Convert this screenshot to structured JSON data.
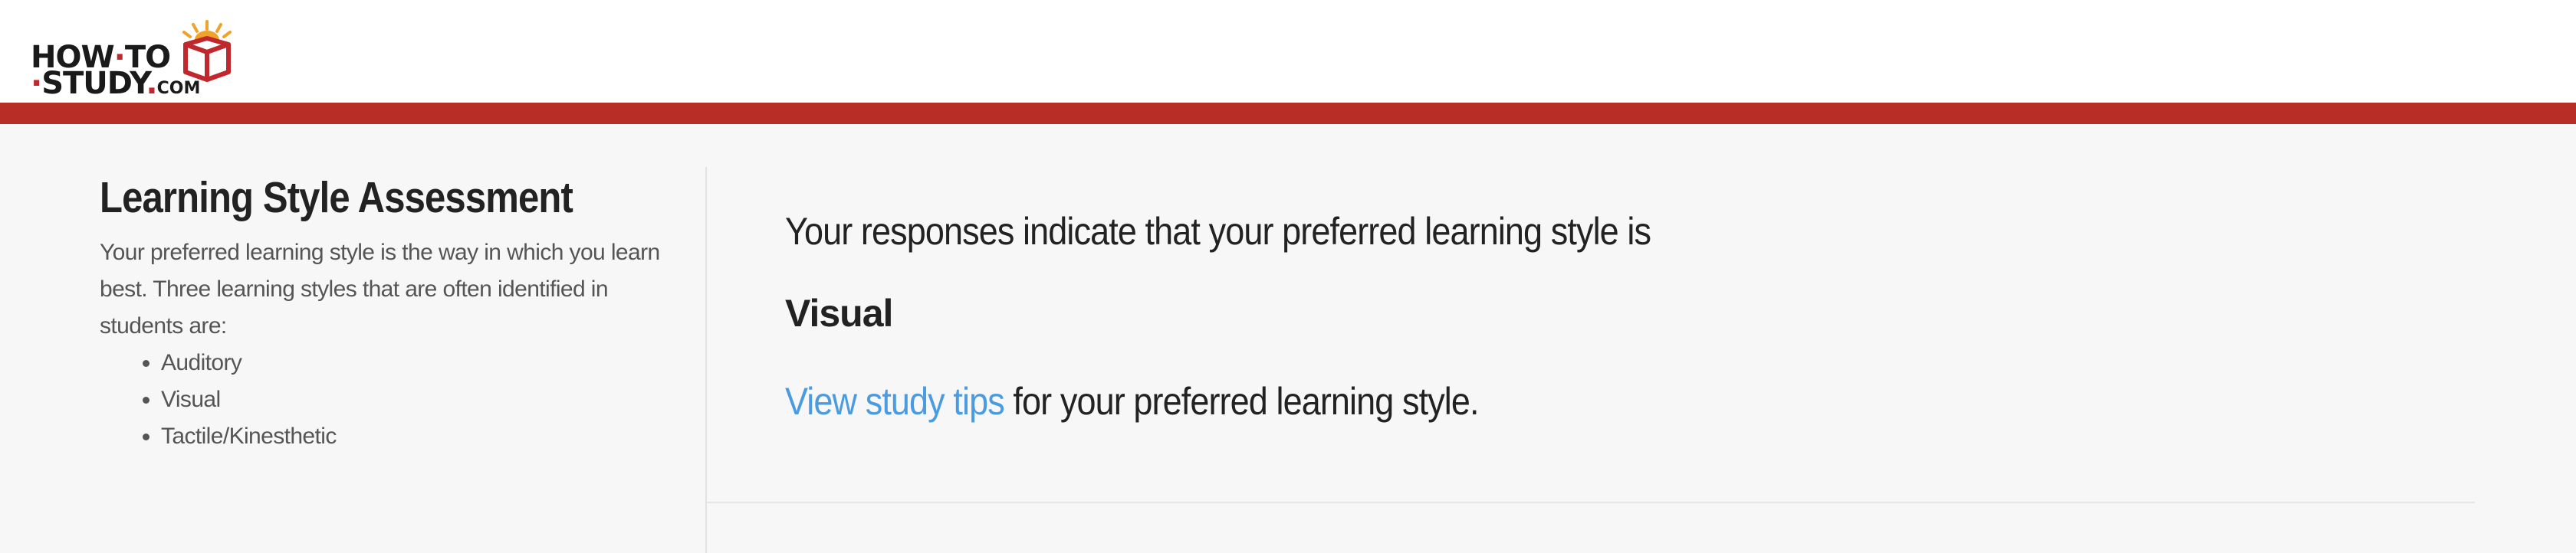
{
  "header": {
    "logo": {
      "line1": "HOW",
      "line1_sep": "·",
      "line1_end": "TO",
      "line2_sep": "·",
      "line2": "STUDY",
      "line2_dot": ".",
      "line2_com": "COM"
    },
    "accent_color": "#b82e26"
  },
  "sidebar": {
    "title": "Learning Style Assessment",
    "description": "Your preferred learning style is the way in which you learn best. Three learning styles that are often identified in students are:",
    "styles": [
      "Auditory",
      "Visual",
      "Tactile/Kinesthetic"
    ]
  },
  "main": {
    "result_text": "Your responses indicate that your preferred learning style is",
    "result_style": "Visual",
    "tips_link_label": "View study tips",
    "tips_suffix": " for your preferred learning style.",
    "link_color": "#4a9be0"
  }
}
